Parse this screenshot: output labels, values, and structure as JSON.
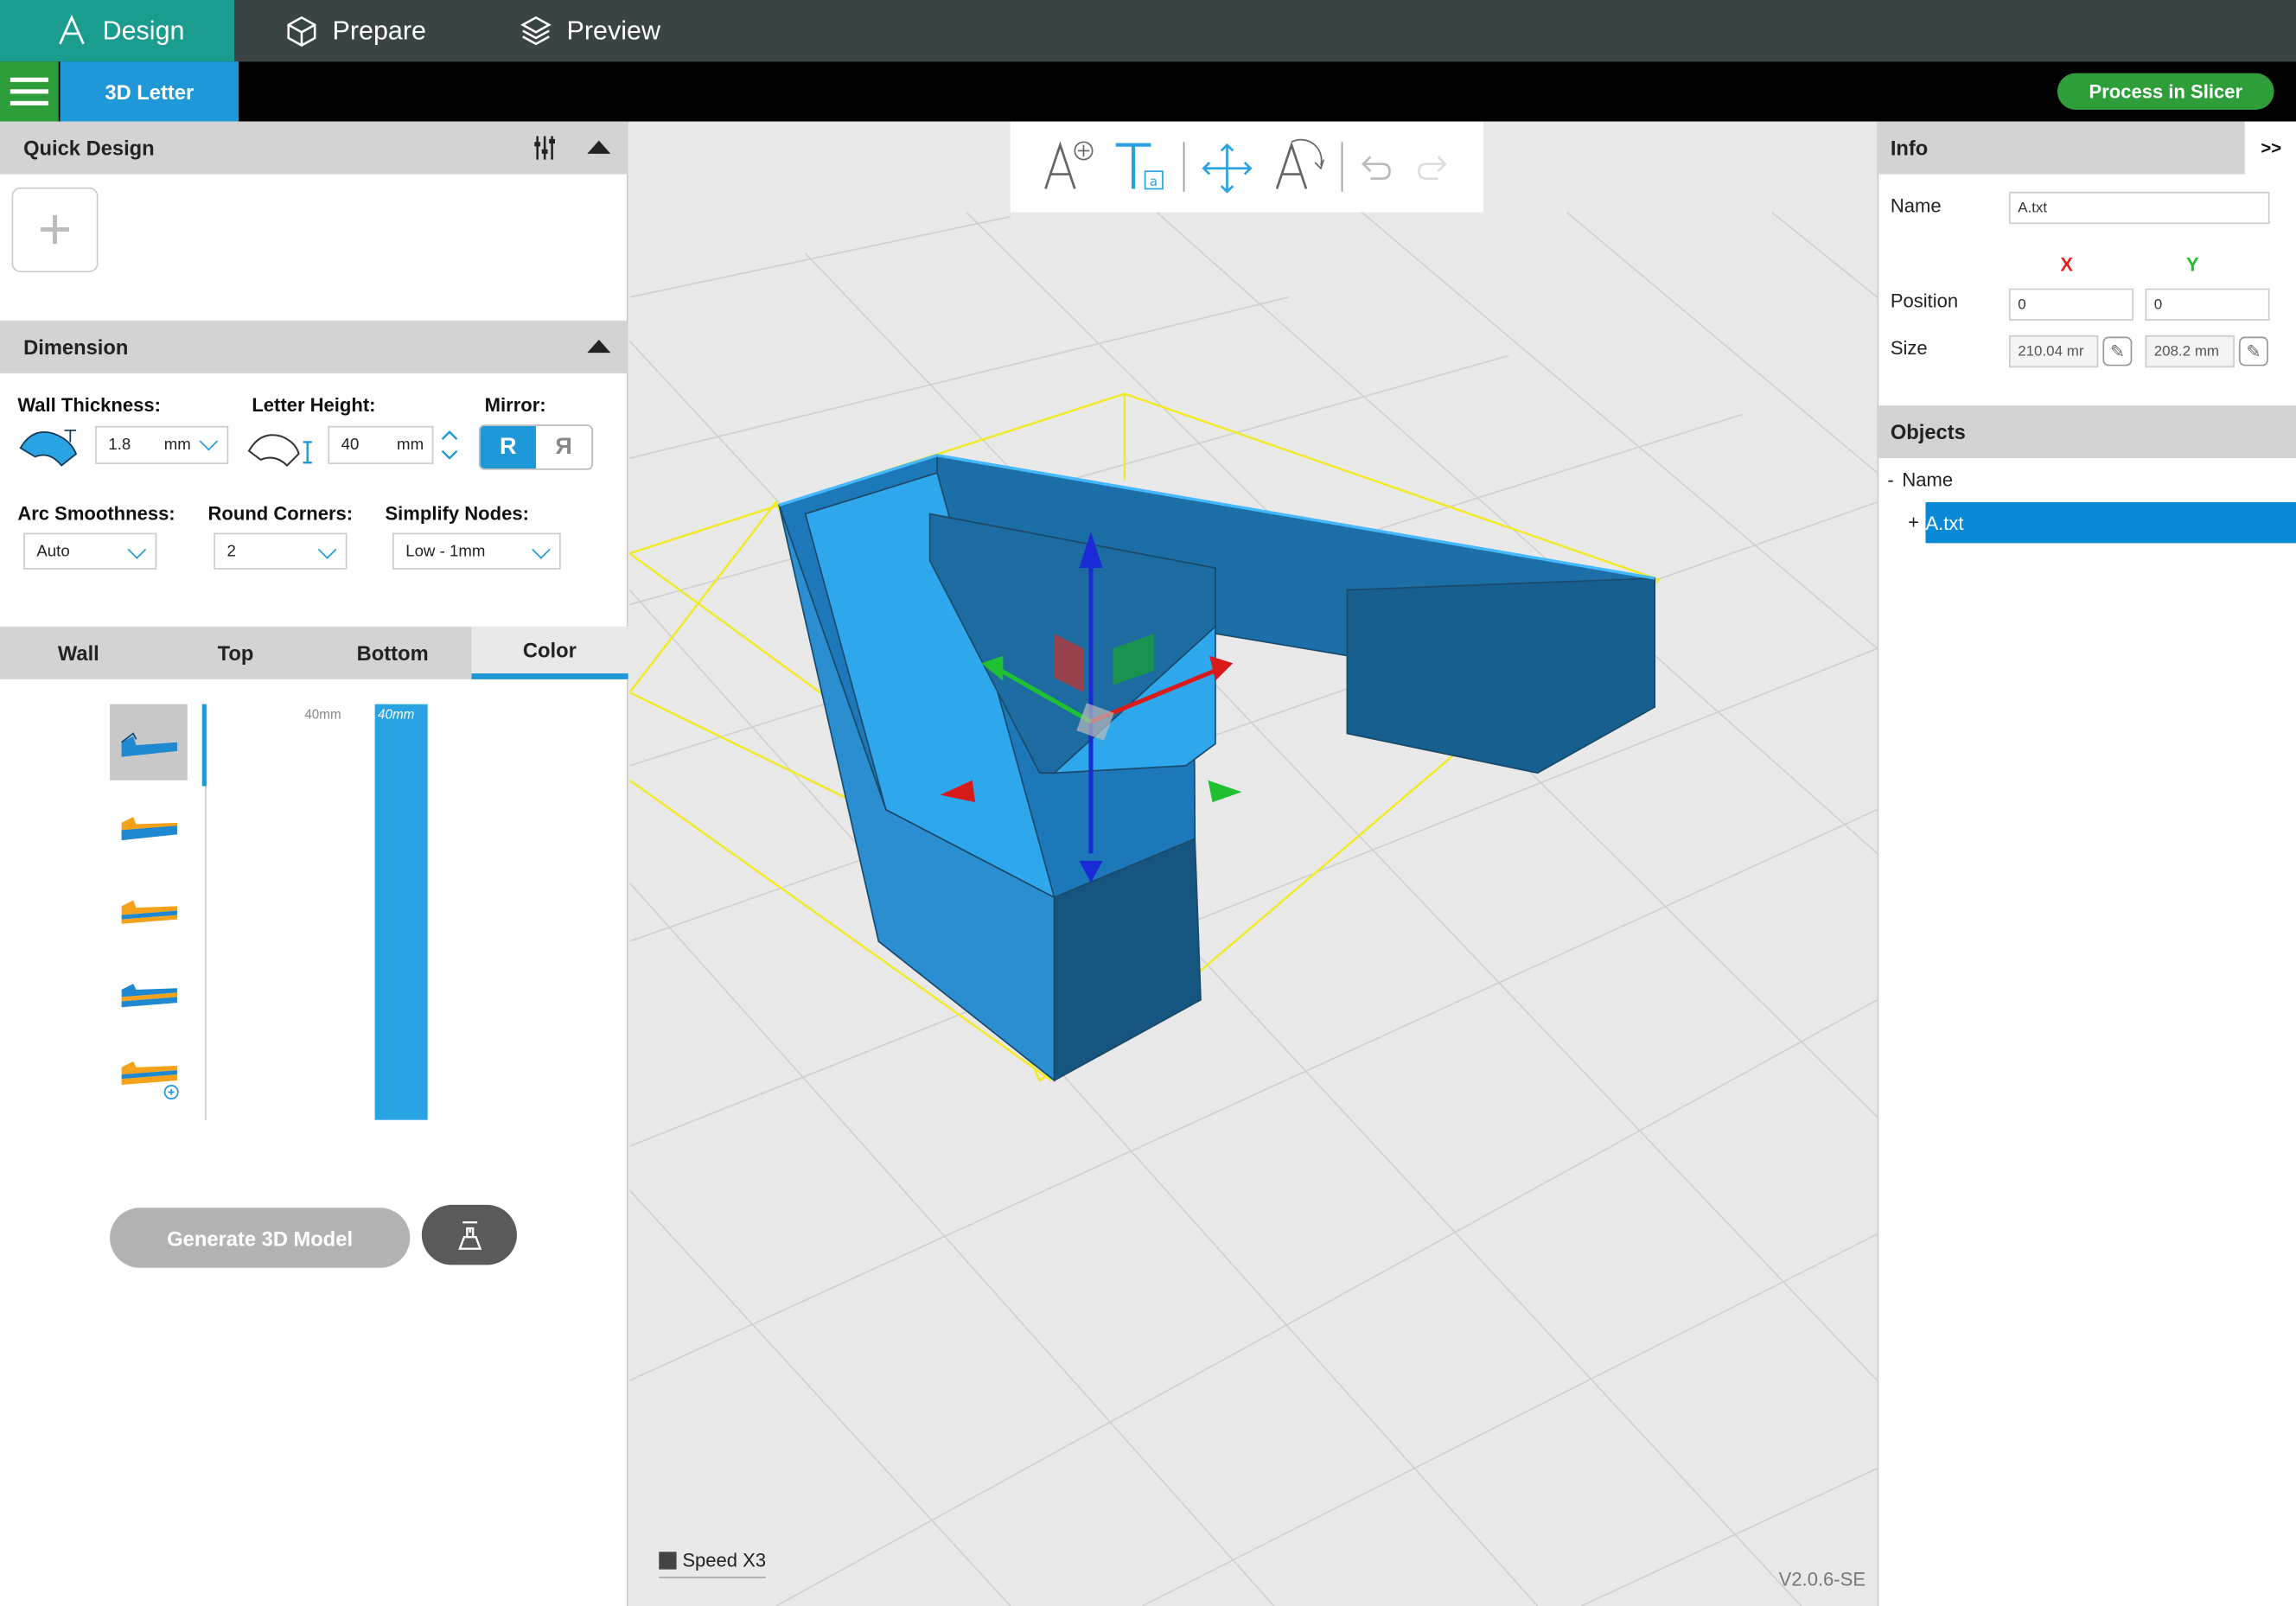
{
  "top_tabs": [
    {
      "label": "Design",
      "icon": "design-icon",
      "active": true
    },
    {
      "label": "Prepare",
      "icon": "cube-icon",
      "active": false
    },
    {
      "label": "Preview",
      "icon": "layers-icon",
      "active": false
    }
  ],
  "subbar": {
    "mode_tab": "3D Letter",
    "process_button": "Process in Slicer"
  },
  "left": {
    "quick_design": "Quick Design",
    "dimension": "Dimension",
    "wall_thickness": {
      "label": "Wall Thickness:",
      "value": "1.8",
      "unit": "mm"
    },
    "letter_height": {
      "label": "Letter Height:",
      "value": "40",
      "unit": "mm"
    },
    "mirror": {
      "label": "Mirror:",
      "normal": "R",
      "mirrored": "Я"
    },
    "arc_smoothness": {
      "label": "Arc Smoothness:",
      "value": "Auto"
    },
    "round_corners": {
      "label": "Round Corners:",
      "value": "2"
    },
    "simplify_nodes": {
      "label": "Simplify Nodes:",
      "value": "Low - 1mm"
    },
    "tabs": [
      "Wall",
      "Top",
      "Bottom",
      "Color"
    ],
    "selected_tab": "Color",
    "bar_axis_label": "40mm",
    "bar_value_label": "40mm",
    "generate_button": "Generate 3D Model"
  },
  "viewport": {
    "speed": "Speed X3",
    "version": "V2.0.6-SE"
  },
  "right": {
    "info": "Info",
    "collapse": ">>",
    "name_label": "Name",
    "name_value": "A.txt",
    "x_label": "X",
    "y_label": "Y",
    "position_label": "Position",
    "position_x": "0",
    "position_y": "0",
    "size_label": "Size",
    "size_x": "210.04 mr",
    "size_y": "208.2 mm",
    "objects": "Objects",
    "tree_header_prefix": "-",
    "tree_header": "Name",
    "tree_item_prefix": "+",
    "tree_item": "A.txt"
  },
  "colors": {
    "accent": "#1e98d6",
    "brand_green": "#2e9e3a",
    "active_tab": "#1a9c8f",
    "model_blue": "#29a3e2"
  }
}
